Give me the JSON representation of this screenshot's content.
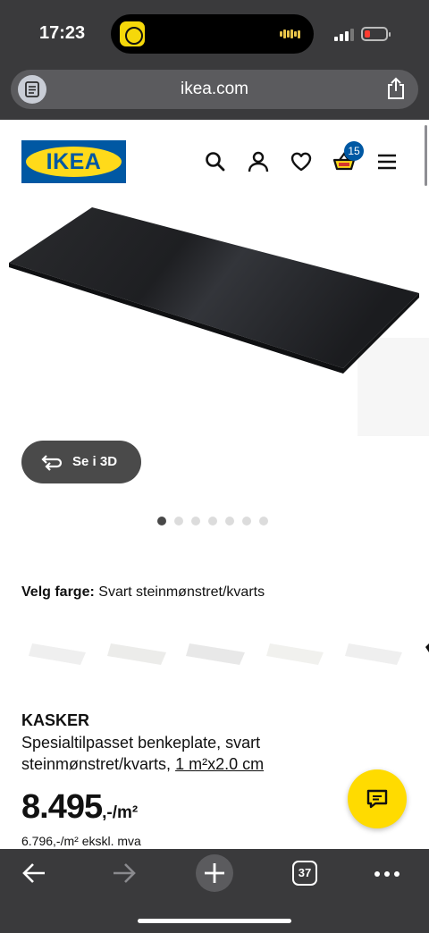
{
  "status_bar": {
    "time": "17:23"
  },
  "browser": {
    "url": "ikea.com",
    "tab_count": "37"
  },
  "header": {
    "logo_text": "IKEA",
    "cart_count": "15"
  },
  "product": {
    "view_3d_label": "Se i 3D",
    "carousel": {
      "total": 7,
      "active": 1
    },
    "color_label": "Velg farge:",
    "color_value": "Svart steinmønstret/kvarts",
    "name": "KASKER",
    "description": "Spesialtilpasset benkeplate, svart steinmønstret/kvarts,",
    "size": "1 m²x2.0 cm",
    "price_main": "8.495",
    "price_unit": ",-/m²",
    "price_ex_vat": "6.796,-/m² ekskl. mva"
  },
  "colors": {
    "ikea_blue": "#0058a3",
    "ikea_yellow": "#ffda1a",
    "chrome": "#3a3a3c"
  },
  "icons": [
    "reader-icon",
    "share-icon",
    "search-icon",
    "user-icon",
    "heart-icon",
    "cart-icon",
    "menu-icon",
    "rotate-3d-icon",
    "chat-icon",
    "back-icon",
    "forward-icon",
    "plus-icon",
    "tabs-icon",
    "more-icon"
  ]
}
